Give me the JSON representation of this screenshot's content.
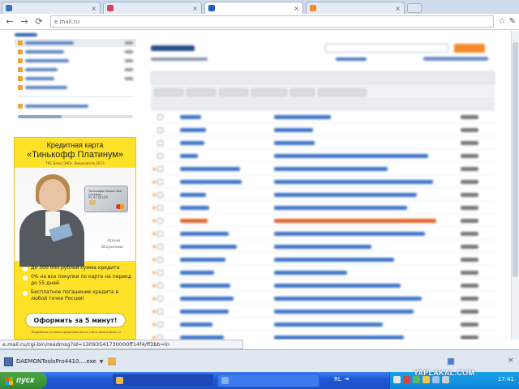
{
  "colors": {
    "ad_yellow": "#ffe227",
    "taskbar_blue": "#1f58d6",
    "start_green": "#3a9a3a",
    "link_blue": "#3f74c8"
  },
  "toolbar": {
    "url": "e.mail.ru",
    "back_icon": "back-arrow-icon",
    "forward_icon": "forward-arrow-icon",
    "reload_icon": "reload-icon"
  },
  "ad": {
    "line1": "Кредитная карта",
    "line2": "«Тинькофф Платинум»",
    "line3": "ТКС Банк (ЗАО). Лицензия № 2673",
    "card": {
      "label": "Тинькофф Кредитные Системы",
      "product": "PLATINUM"
    },
    "signature1": "Арина",
    "signature2": "Шарапова",
    "bullets": [
      "До 300 000 рублей сумма кредита",
      "0% на все покупки по карте на период до 55 дней",
      "Бесплатное погашение кредита в любой точке России!"
    ],
    "button": "Оформить за 5 минут!",
    "footer": "Подробные условия кредитования на сайте www.tcsbank.ru"
  },
  "status_url": "e.mail.ru/cgi-bin/readmsg?id=13093541730000ff14f4/ff3bb=ln",
  "downloads": {
    "item1": "DAEMONToolsPro4410....exe",
    "item1_arrow": "▼"
  },
  "taskbar": {
    "start": "пуск",
    "language": "RL",
    "clock": "17:41",
    "watermark": "YAPLAKAL.COM"
  }
}
